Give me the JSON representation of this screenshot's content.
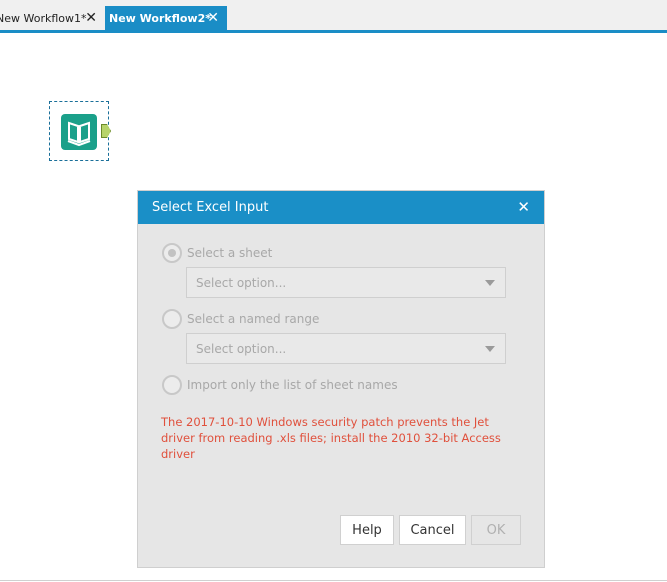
{
  "tabs": [
    {
      "label": "New Workflow1*",
      "close": "✕"
    },
    {
      "label": "New Workflow2*",
      "close": "✕"
    }
  ],
  "dialog": {
    "title": "Select Excel Input",
    "close": "✕",
    "options": [
      {
        "label": "Select a sheet",
        "selected": true,
        "dropdown": "Select option..."
      },
      {
        "label": "Select a named range",
        "selected": false,
        "dropdown": "Select option..."
      },
      {
        "label": "Import only the list of sheet names",
        "selected": false
      }
    ],
    "warning": "The 2017-10-10 Windows security patch prevents the Jet driver from reading .xls files; install the 2010 32-bit Access driver",
    "buttons": {
      "help": "Help",
      "cancel": "Cancel",
      "ok": "OK"
    }
  },
  "colors": {
    "accent": "#1a8dc6",
    "warning": "#e0503c",
    "tool": "#1aa08a"
  }
}
